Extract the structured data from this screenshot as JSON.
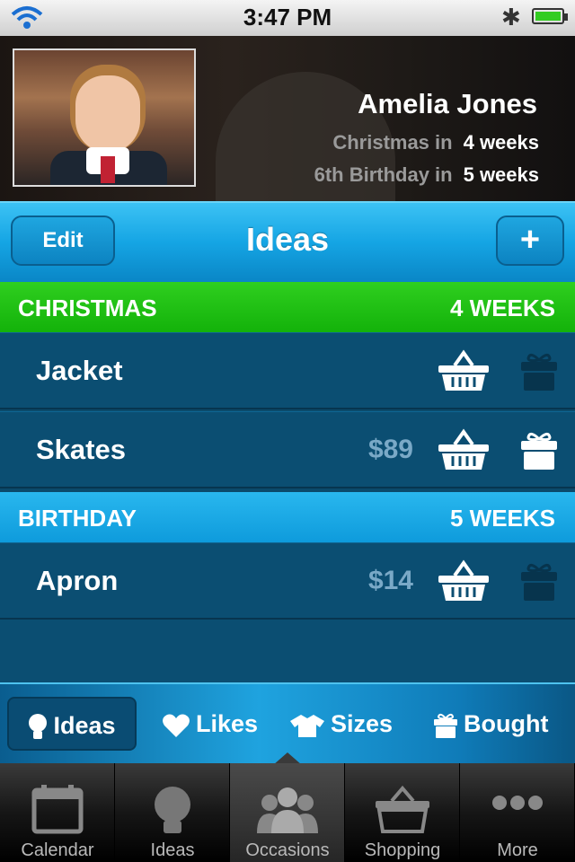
{
  "status": {
    "time": "3:47 PM"
  },
  "profile": {
    "name": "Amelia Jones",
    "occasions": [
      {
        "label": "Christmas in",
        "value": "4 weeks"
      },
      {
        "label": "6th Birthday in",
        "value": "5 weeks"
      }
    ]
  },
  "nav": {
    "title": "Ideas",
    "edit_label": "Edit",
    "add_label": "+"
  },
  "sections": [
    {
      "name": "CHRISTMAS",
      "when": "4 WEEKS",
      "color": "#1fbf12",
      "items": [
        {
          "title": "Jacket",
          "price": "",
          "gift_state": "not-bought"
        },
        {
          "title": "Skates",
          "price": "$89",
          "gift_state": "bought"
        }
      ]
    },
    {
      "name": "BIRTHDAY",
      "when": "5 WEEKS",
      "color": "#14a5e6",
      "items": [
        {
          "title": "Apron",
          "price": "$14",
          "gift_state": "not-bought"
        }
      ]
    }
  ],
  "segments": [
    {
      "label": "Ideas",
      "icon": "lightbulb-icon",
      "active": true
    },
    {
      "label": "Likes",
      "icon": "heart-icon",
      "active": false
    },
    {
      "label": "Sizes",
      "icon": "shirt-icon",
      "active": false
    },
    {
      "label": "Bought",
      "icon": "gift-icon",
      "active": false
    }
  ],
  "tabs": [
    {
      "label": "Calendar",
      "icon": "calendar-icon"
    },
    {
      "label": "Ideas",
      "icon": "lightbulb-icon"
    },
    {
      "label": "Occasions",
      "icon": "people-icon",
      "selected": true
    },
    {
      "label": "Shopping",
      "icon": "basket-icon"
    },
    {
      "label": "More",
      "icon": "more-dots-icon"
    }
  ]
}
